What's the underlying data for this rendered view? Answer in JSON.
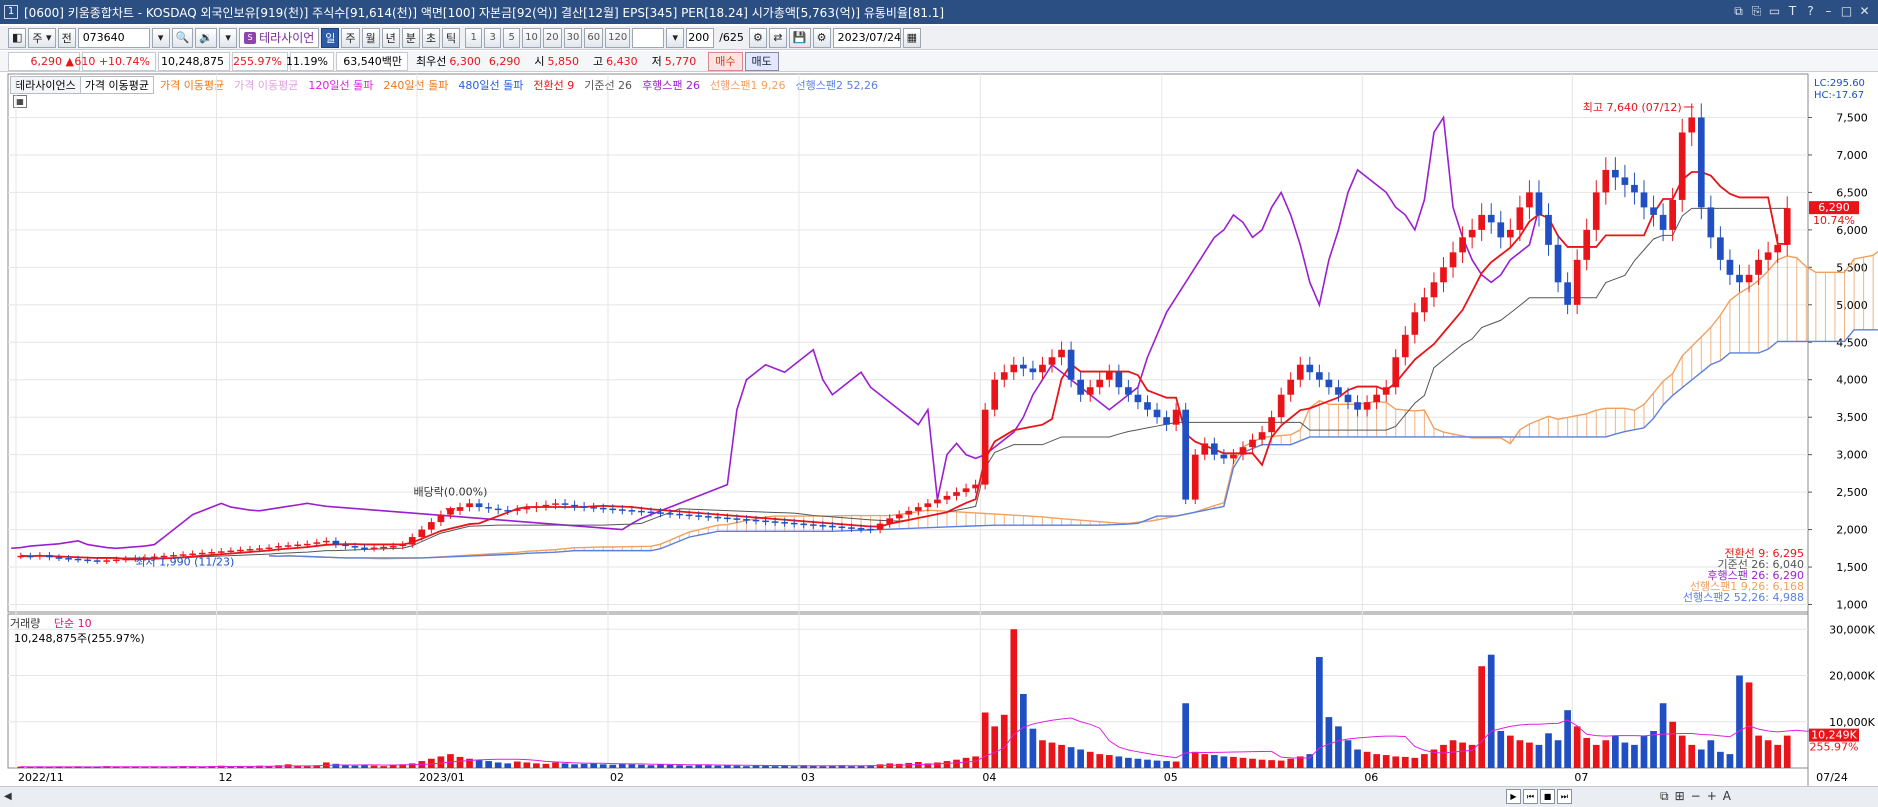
{
  "title_bar": {
    "window_number": "1",
    "text": "[0600] 키움종합차트 - KOSDAQ 외국인보유[919(천)] 주식수[91,614(천)] 액면[100] 자본금[92(억)] 결산[12월] EPS[345] PER[18.24] 시가총액[5,763(억)] 유통비율[81.1]"
  },
  "toolbar": {
    "period_select": "주",
    "period_label": "전",
    "stock_code": "073640",
    "stock_name": "테라사이언",
    "stock_logo": "S",
    "intervals": [
      "일",
      "주",
      "월",
      "년",
      "분",
      "초",
      "틱"
    ],
    "active_interval": "일",
    "minute_options": [
      "1",
      "3",
      "5",
      "10",
      "20",
      "30",
      "60",
      "120"
    ],
    "count": "200",
    "count_total": "/625",
    "date": "2023/07/24"
  },
  "quote": {
    "price": "6,290",
    "arrow": "▲",
    "change": "610",
    "change_pct": "+10.74%",
    "volume": "10,248,875",
    "vol_ratio": "255.97%",
    "turnover": "11.19%",
    "amount": "63,540백만",
    "best_bid_label": "최우선",
    "best_ask": "6,300",
    "best_bid": "6,290",
    "open_label": "시",
    "open": "5,850",
    "high_label": "고",
    "high": "6,430",
    "low_label": "저",
    "low": "5,770",
    "buy_label": "매수",
    "sell_label": "매도"
  },
  "legend": {
    "stock_tab": "테라사이언스",
    "ma_tab": "가격 이동평균",
    "items": [
      {
        "text": "가격 이동평균",
        "color": "#f07818"
      },
      {
        "text": "가격 이동평균",
        "color": "#e0a0e0"
      },
      {
        "text": "120일선 돌파",
        "color": "#e020e0"
      },
      {
        "text": "240일선 돌파",
        "color": "#f07818"
      },
      {
        "text": "480일선 돌파",
        "color": "#2060e0"
      },
      {
        "text": "전환선 9",
        "color": "#e8141a"
      },
      {
        "text": "기준선 26",
        "color": "#555555"
      },
      {
        "text": "후행스팬 26",
        "color": "#9b1fd1"
      },
      {
        "text": "선행스팬1 9,26",
        "color": "#f0a060"
      },
      {
        "text": "선행스팬2 52,26",
        "color": "#5b7fe0"
      }
    ]
  },
  "right_info": {
    "lc": "LC:295.60",
    "hc": "HC:-17.67"
  },
  "price_axis": {
    "labels": [
      "7,500",
      "7,000",
      "6,500",
      "6,000",
      "5,500",
      "5,000",
      "4,500",
      "4,000",
      "3,500",
      "3,000",
      "2,500",
      "2,000",
      "1,500",
      "1,000"
    ],
    "current_tag": "6,290",
    "current_pct": "10.74%"
  },
  "annotations": {
    "high": "최고 7,640 (07/12)",
    "dividend": "배당락(0.00%)",
    "low": "최저 1,990 (11/23)"
  },
  "indicator_values": [
    {
      "text": "전환선 9: 6,295",
      "color": "#e8141a"
    },
    {
      "text": "기준선 26: 6,040",
      "color": "#555555"
    },
    {
      "text": "후행스팬 26: 6,290",
      "color": "#9b1fd1"
    },
    {
      "text": "선행스팬1 9,26: 6,168",
      "color": "#f0a060"
    },
    {
      "text": "선행스팬2 52,26: 4,988",
      "color": "#5b7fe0"
    }
  ],
  "volume_panel": {
    "legend_title": "거래량",
    "legend_ma": "단순 10",
    "value_text": "10,248,875주(255.97%)",
    "axis_labels": [
      "30,000K",
      "20,000K",
      "10,000K"
    ],
    "current_tag": "10,249K",
    "current_pct": "255.97%"
  },
  "x_axis": {
    "labels": [
      "2022/11",
      "12",
      "2023/01",
      "02",
      "03",
      "04",
      "05",
      "06",
      "07"
    ],
    "end_label": "07/24"
  },
  "colors": {
    "up": "#e8141a",
    "down": "#1f4fc2",
    "conversion": "#e8141a",
    "base": "#555555",
    "lagging": "#9b1fd1",
    "span1": "#f0a060",
    "span2": "#5b7fe0",
    "volume_ma": "#e020e0"
  },
  "chart_data": {
    "type": "candlestick",
    "ylim": [
      900,
      7800
    ],
    "y_ticks": [
      1000,
      1500,
      2000,
      2500,
      3000,
      3500,
      4000,
      4500,
      5000,
      5500,
      6000,
      6500,
      7000,
      7500
    ],
    "x_month_starts": [
      0,
      21,
      42,
      62,
      82,
      101,
      120,
      141,
      163
    ],
    "closes": [
      1650,
      1640,
      1660,
      1630,
      1620,
      1610,
      1600,
      1590,
      1580,
      1590,
      1600,
      1610,
      1620,
      1630,
      1640,
      1650,
      1660,
      1670,
      1680,
      1690,
      1700,
      1710,
      1720,
      1730,
      1740,
      1750,
      1760,
      1780,
      1790,
      1800,
      1810,
      1830,
      1850,
      1800,
      1780,
      1760,
      1750,
      1760,
      1770,
      1780,
      1800,
      1900,
      2000,
      2100,
      2200,
      2250,
      2300,
      2350,
      2300,
      2280,
      2260,
      2250,
      2270,
      2290,
      2310,
      2330,
      2350,
      2330,
      2310,
      2300,
      2290,
      2280,
      2270,
      2260,
      2250,
      2240,
      2230,
      2220,
      2210,
      2200,
      2190,
      2180,
      2170,
      2160,
      2150,
      2140,
      2130,
      2120,
      2110,
      2100,
      2090,
      2080,
      2070,
      2060,
      2050,
      2040,
      2030,
      2020,
      2010,
      2000,
      2080,
      2150,
      2200,
      2250,
      2300,
      2350,
      2400,
      2450,
      2500,
      2550,
      2600,
      3600,
      4000,
      4100,
      4200,
      4150,
      4100,
      4200,
      4300,
      4400,
      4000,
      3800,
      3900,
      4000,
      4100,
      3900,
      3800,
      3700,
      3600,
      3500,
      3400,
      3600,
      2400,
      3000,
      3150,
      3000,
      2950,
      3000,
      3100,
      3200,
      3300,
      3500,
      3800,
      4000,
      4200,
      4100,
      4000,
      3900,
      3800,
      3700,
      3600,
      3700,
      3800,
      3900,
      4300,
      4600,
      4900,
      5100,
      5300,
      5500,
      5700,
      5900,
      6000,
      6200,
      6100,
      5900,
      6000,
      6300,
      6500,
      6200,
      5800,
      5300,
      5000,
      5600,
      6000,
      6500,
      6800,
      6700,
      6600,
      6500,
      6300,
      6200,
      6000,
      6400,
      7300,
      7500,
      6300,
      5900,
      5600,
      5400,
      5300,
      5400,
      5600,
      5700,
      5800,
      6290
    ],
    "volumes": [
      0.3,
      0.2,
      0.3,
      0.2,
      0.3,
      0.2,
      0.3,
      0.2,
      0.3,
      0.4,
      0.3,
      0.2,
      0.3,
      0.2,
      0.3,
      0.2,
      0.3,
      0.4,
      0.3,
      0.3,
      0.4,
      0.5,
      0.3,
      0.4,
      0.3,
      0.5,
      0.4,
      0.6,
      0.8,
      0.5,
      0.4,
      0.6,
      1.2,
      0.9,
      0.6,
      0.5,
      0.7,
      0.5,
      0.4,
      0.6,
      0.8,
      1.0,
      1.5,
      2.0,
      2.5,
      3.0,
      2.4,
      2.0,
      1.8,
      1.5,
      1.2,
      1.0,
      1.4,
      1.2,
      1.0,
      0.9,
      1.2,
      1.0,
      0.8,
      0.9,
      1.0,
      0.8,
      0.7,
      0.9,
      0.8,
      0.7,
      0.6,
      0.8,
      0.7,
      0.6,
      0.5,
      0.7,
      0.6,
      0.5,
      0.6,
      0.5,
      0.4,
      0.6,
      0.5,
      0.4,
      0.5,
      0.4,
      0.6,
      0.5,
      0.4,
      0.5,
      0.6,
      0.4,
      0.5,
      0.6,
      0.8,
      1.0,
      0.9,
      1.1,
      1.3,
      1.0,
      1.2,
      1.5,
      1.8,
      2.2,
      2.5,
      12.0,
      9.0,
      11.5,
      30.0,
      16.0,
      8.5,
      6.0,
      5.5,
      5.0,
      4.5,
      4.0,
      3.5,
      3.0,
      2.8,
      2.5,
      2.2,
      2.0,
      1.8,
      1.6,
      1.5,
      1.4,
      14.0,
      3.5,
      3.0,
      2.8,
      2.5,
      2.4,
      2.2,
      2.0,
      1.8,
      1.7,
      1.6,
      2.0,
      2.5,
      3.0,
      24.0,
      11.0,
      9.0,
      6.0,
      4.0,
      3.5,
      3.0,
      2.8,
      2.5,
      2.4,
      2.2,
      3.0,
      4.0,
      5.0,
      6.0,
      5.5,
      5.0,
      22.0,
      24.5,
      8.0,
      7.0,
      6.0,
      5.5,
      5.0,
      7.5,
      6.0,
      12.5,
      9.0,
      6.5,
      5.0,
      6.0,
      7.0,
      5.5,
      5.0,
      7.0,
      8.0,
      14.0,
      10.0,
      7.0,
      5.0,
      4.0,
      6.0,
      3.5,
      3.0,
      20.0,
      18.5,
      7.0,
      6.0,
      5.0,
      7.0,
      5.5,
      4.0,
      5.0,
      4.0,
      10.2
    ],
    "conversion_line": "",
    "base_line": ""
  }
}
